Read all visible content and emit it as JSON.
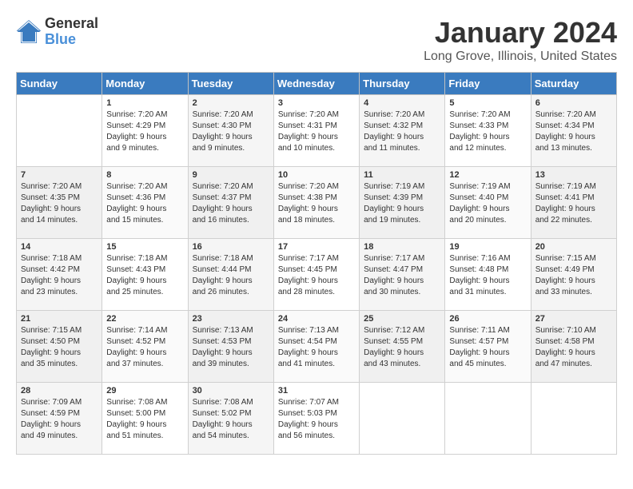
{
  "logo": {
    "general": "General",
    "blue": "Blue"
  },
  "title": "January 2024",
  "subtitle": "Long Grove, Illinois, United States",
  "headers": [
    "Sunday",
    "Monday",
    "Tuesday",
    "Wednesday",
    "Thursday",
    "Friday",
    "Saturday"
  ],
  "weeks": [
    [
      {
        "day": "",
        "info": ""
      },
      {
        "day": "1",
        "info": "Sunrise: 7:20 AM\nSunset: 4:29 PM\nDaylight: 9 hours\nand 9 minutes."
      },
      {
        "day": "2",
        "info": "Sunrise: 7:20 AM\nSunset: 4:30 PM\nDaylight: 9 hours\nand 9 minutes."
      },
      {
        "day": "3",
        "info": "Sunrise: 7:20 AM\nSunset: 4:31 PM\nDaylight: 9 hours\nand 10 minutes."
      },
      {
        "day": "4",
        "info": "Sunrise: 7:20 AM\nSunset: 4:32 PM\nDaylight: 9 hours\nand 11 minutes."
      },
      {
        "day": "5",
        "info": "Sunrise: 7:20 AM\nSunset: 4:33 PM\nDaylight: 9 hours\nand 12 minutes."
      },
      {
        "day": "6",
        "info": "Sunrise: 7:20 AM\nSunset: 4:34 PM\nDaylight: 9 hours\nand 13 minutes."
      }
    ],
    [
      {
        "day": "7",
        "info": "Sunrise: 7:20 AM\nSunset: 4:35 PM\nDaylight: 9 hours\nand 14 minutes."
      },
      {
        "day": "8",
        "info": "Sunrise: 7:20 AM\nSunset: 4:36 PM\nDaylight: 9 hours\nand 15 minutes."
      },
      {
        "day": "9",
        "info": "Sunrise: 7:20 AM\nSunset: 4:37 PM\nDaylight: 9 hours\nand 16 minutes."
      },
      {
        "day": "10",
        "info": "Sunrise: 7:20 AM\nSunset: 4:38 PM\nDaylight: 9 hours\nand 18 minutes."
      },
      {
        "day": "11",
        "info": "Sunrise: 7:19 AM\nSunset: 4:39 PM\nDaylight: 9 hours\nand 19 minutes."
      },
      {
        "day": "12",
        "info": "Sunrise: 7:19 AM\nSunset: 4:40 PM\nDaylight: 9 hours\nand 20 minutes."
      },
      {
        "day": "13",
        "info": "Sunrise: 7:19 AM\nSunset: 4:41 PM\nDaylight: 9 hours\nand 22 minutes."
      }
    ],
    [
      {
        "day": "14",
        "info": "Sunrise: 7:18 AM\nSunset: 4:42 PM\nDaylight: 9 hours\nand 23 minutes."
      },
      {
        "day": "15",
        "info": "Sunrise: 7:18 AM\nSunset: 4:43 PM\nDaylight: 9 hours\nand 25 minutes."
      },
      {
        "day": "16",
        "info": "Sunrise: 7:18 AM\nSunset: 4:44 PM\nDaylight: 9 hours\nand 26 minutes."
      },
      {
        "day": "17",
        "info": "Sunrise: 7:17 AM\nSunset: 4:45 PM\nDaylight: 9 hours\nand 28 minutes."
      },
      {
        "day": "18",
        "info": "Sunrise: 7:17 AM\nSunset: 4:47 PM\nDaylight: 9 hours\nand 30 minutes."
      },
      {
        "day": "19",
        "info": "Sunrise: 7:16 AM\nSunset: 4:48 PM\nDaylight: 9 hours\nand 31 minutes."
      },
      {
        "day": "20",
        "info": "Sunrise: 7:15 AM\nSunset: 4:49 PM\nDaylight: 9 hours\nand 33 minutes."
      }
    ],
    [
      {
        "day": "21",
        "info": "Sunrise: 7:15 AM\nSunset: 4:50 PM\nDaylight: 9 hours\nand 35 minutes."
      },
      {
        "day": "22",
        "info": "Sunrise: 7:14 AM\nSunset: 4:52 PM\nDaylight: 9 hours\nand 37 minutes."
      },
      {
        "day": "23",
        "info": "Sunrise: 7:13 AM\nSunset: 4:53 PM\nDaylight: 9 hours\nand 39 minutes."
      },
      {
        "day": "24",
        "info": "Sunrise: 7:13 AM\nSunset: 4:54 PM\nDaylight: 9 hours\nand 41 minutes."
      },
      {
        "day": "25",
        "info": "Sunrise: 7:12 AM\nSunset: 4:55 PM\nDaylight: 9 hours\nand 43 minutes."
      },
      {
        "day": "26",
        "info": "Sunrise: 7:11 AM\nSunset: 4:57 PM\nDaylight: 9 hours\nand 45 minutes."
      },
      {
        "day": "27",
        "info": "Sunrise: 7:10 AM\nSunset: 4:58 PM\nDaylight: 9 hours\nand 47 minutes."
      }
    ],
    [
      {
        "day": "28",
        "info": "Sunrise: 7:09 AM\nSunset: 4:59 PM\nDaylight: 9 hours\nand 49 minutes."
      },
      {
        "day": "29",
        "info": "Sunrise: 7:08 AM\nSunset: 5:00 PM\nDaylight: 9 hours\nand 51 minutes."
      },
      {
        "day": "30",
        "info": "Sunrise: 7:08 AM\nSunset: 5:02 PM\nDaylight: 9 hours\nand 54 minutes."
      },
      {
        "day": "31",
        "info": "Sunrise: 7:07 AM\nSunset: 5:03 PM\nDaylight: 9 hours\nand 56 minutes."
      },
      {
        "day": "",
        "info": ""
      },
      {
        "day": "",
        "info": ""
      },
      {
        "day": "",
        "info": ""
      }
    ]
  ]
}
